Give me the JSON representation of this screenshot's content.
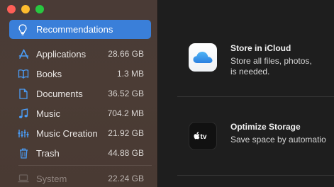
{
  "sidebar": {
    "selected": {
      "label": "Recommendations",
      "icon": "lightbulb-icon"
    },
    "items": [
      {
        "label": "Applications",
        "size": "28.66 GB",
        "icon": "applications-icon"
      },
      {
        "label": "Books",
        "size": "1.3 MB",
        "icon": "book-icon"
      },
      {
        "label": "Documents",
        "size": "36.52 GB",
        "icon": "document-icon"
      },
      {
        "label": "Music",
        "size": "704.2 MB",
        "icon": "music-note-icon"
      },
      {
        "label": "Music Creation",
        "size": "21.92 GB",
        "icon": "music-creation-icon"
      },
      {
        "label": "Trash",
        "size": "44.88 GB",
        "icon": "trash-icon"
      }
    ],
    "system": {
      "label": "System",
      "size": "22.24 GB",
      "icon": "laptop-icon"
    }
  },
  "main": {
    "recommendations": [
      {
        "title": "Store in iCloud",
        "desc_line1": "Store all files, photos,",
        "desc_line2": "is needed.",
        "icon": "icloud-icon"
      },
      {
        "title": "Optimize Storage",
        "desc_line1": "Save space by automatio",
        "desc_line2": "",
        "icon": "apple-tv-icon",
        "icon_text": "tv"
      }
    ]
  },
  "colors": {
    "accent": "#3a7fd9",
    "sidebar_bg": "#4a3b36",
    "main_bg": "#1e1e1e",
    "icon_blue": "#4a9cf5"
  }
}
